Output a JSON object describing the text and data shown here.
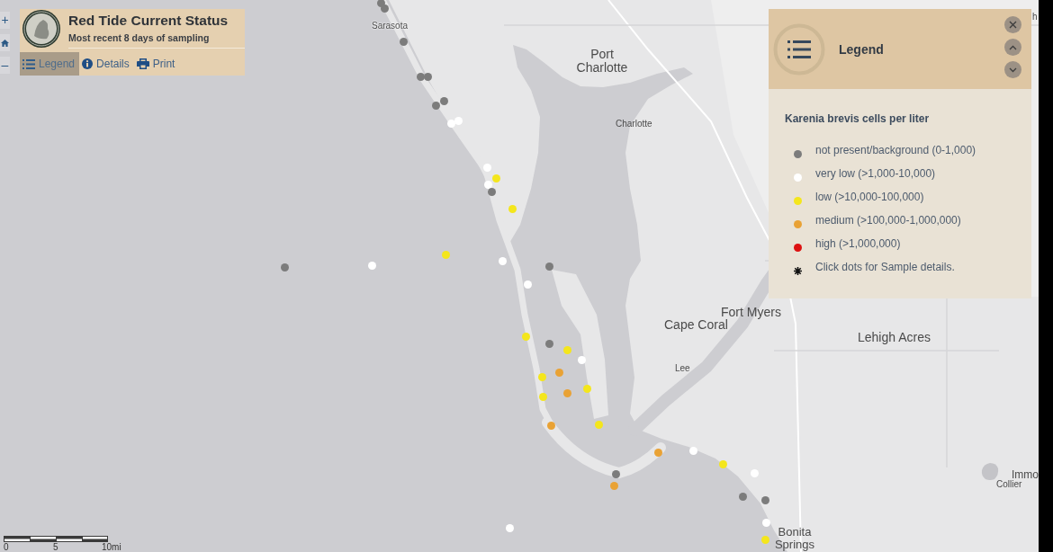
{
  "map_controls": {
    "zoom_in": "+",
    "zoom_out": "–"
  },
  "header": {
    "title": "Red Tide Current Status",
    "subtitle": "Most recent 8 days of sampling",
    "tabs": [
      {
        "label": "Legend",
        "selected": true
      },
      {
        "label": "Details",
        "selected": false
      },
      {
        "label": "Print",
        "selected": false
      }
    ]
  },
  "map": {
    "places": [
      "h",
      "Sarasota",
      "Port Charlotte",
      "Charlotte",
      "Fort Myers",
      "Cape Coral",
      "Lehigh Acres",
      "Lee",
      "Immo",
      "Collier",
      "Bonita Springs"
    ],
    "samples": [
      {
        "color": "#7c7c7c"
      },
      {
        "color": "#7c7c7c"
      },
      {
        "color": "#7c7c7c"
      },
      {
        "color": "#7c7c7c"
      },
      {
        "color": "#7c7c7c"
      },
      {
        "color": "#7c7c7c"
      },
      {
        "color": "#7c7c7c"
      },
      {
        "color": "#ffffff"
      },
      {
        "color": "#ffffff"
      },
      {
        "color": "#ffffff"
      },
      {
        "color": "#f4e61c"
      },
      {
        "color": "#ffffff"
      },
      {
        "color": "#7c7c7c"
      },
      {
        "color": "#f4e61c"
      },
      {
        "color": "#f4e61c"
      },
      {
        "color": "#ffffff"
      },
      {
        "color": "#ffffff"
      },
      {
        "color": "#7c7c7c"
      },
      {
        "color": "#7c7c7c"
      },
      {
        "color": "#ffffff"
      },
      {
        "color": "#f4e61c"
      },
      {
        "color": "#7c7c7c"
      },
      {
        "color": "#f4e61c"
      },
      {
        "color": "#ffffff"
      },
      {
        "color": "#e9a235"
      },
      {
        "color": "#f4e61c"
      },
      {
        "color": "#f4e61c"
      },
      {
        "color": "#e9a235"
      },
      {
        "color": "#f4e61c"
      },
      {
        "color": "#f4e61c"
      },
      {
        "color": "#e9a235"
      },
      {
        "color": "#ffffff"
      },
      {
        "color": "#e9a235"
      },
      {
        "color": "#f4e61c"
      },
      {
        "color": "#ffffff"
      },
      {
        "color": "#7c7c7c"
      },
      {
        "color": "#e9a235"
      },
      {
        "color": "#7c7c7c"
      },
      {
        "color": "#7c7c7c"
      },
      {
        "color": "#ffffff"
      },
      {
        "color": "#ffffff"
      },
      {
        "color": "#f4e61c"
      }
    ]
  },
  "legend": {
    "title": "Legend",
    "heading": "Karenia brevis cells per liter",
    "items": [
      {
        "kind": "dot",
        "label": "not present/background (0-1,000)",
        "color": "#7c7c7c"
      },
      {
        "kind": "dot",
        "label": "very low (>1,000-10,000)",
        "color": "#ffffff"
      },
      {
        "kind": "dot",
        "label": "low (>10,000-100,000)",
        "color": "#f4e61c"
      },
      {
        "kind": "dot",
        "label": "medium (>100,000-1,000,000)",
        "color": "#e9a235"
      },
      {
        "kind": "dot",
        "label": "high (>1,000,000)",
        "color": "#dd1111"
      },
      {
        "kind": "note",
        "label": "Click dots for Sample details."
      }
    ]
  },
  "scale_bar": {
    "labels": [
      "0",
      "5",
      "10mi"
    ]
  }
}
